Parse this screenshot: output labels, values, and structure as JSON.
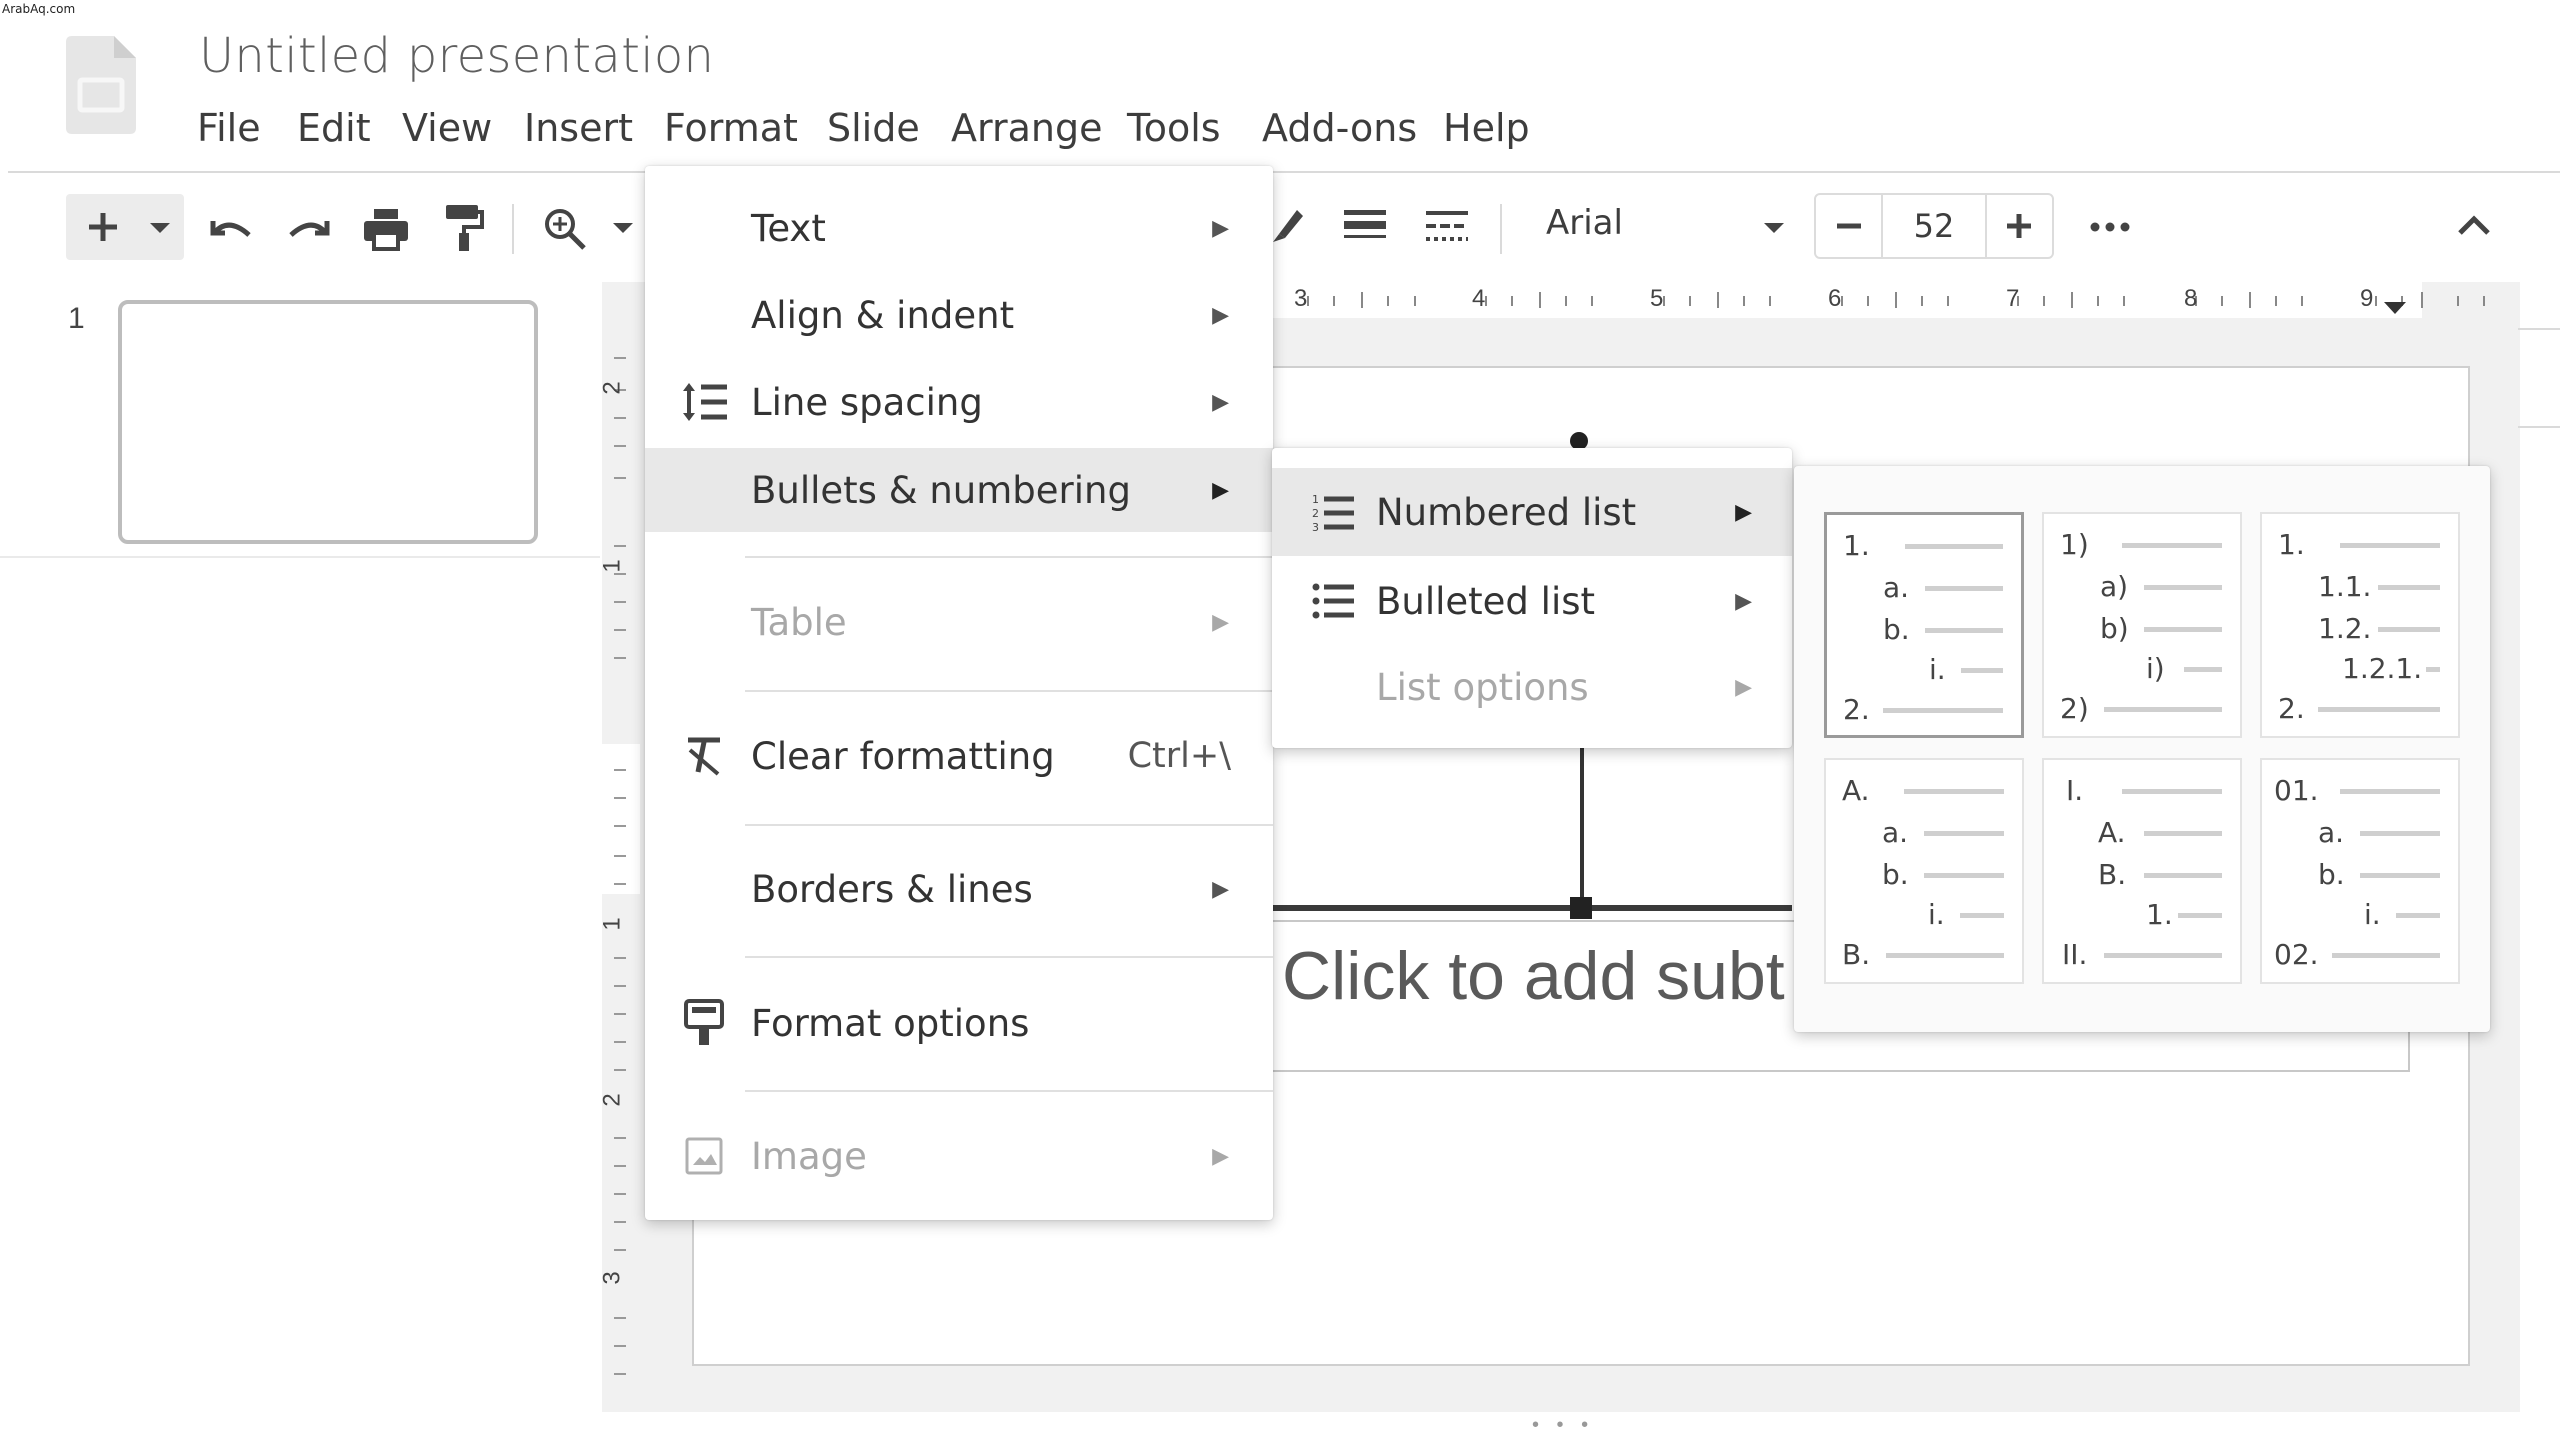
{
  "watermark": "ArabAq.com",
  "app": {
    "title": "Untitled presentation"
  },
  "menubar": [
    "File",
    "Edit",
    "View",
    "Insert",
    "Format",
    "Slide",
    "Arrange",
    "Tools",
    "Add-ons",
    "Help"
  ],
  "toolbar": {
    "font": "Arial",
    "font_size": "52",
    "icons": [
      "new-slide-icon",
      "undo-icon",
      "redo-icon",
      "print-icon",
      "paint-format-icon",
      "zoom-icon",
      "pen-icon",
      "line-weight-icon",
      "line-dash-icon",
      "minus-icon",
      "plus-icon",
      "more-icon",
      "collapse-icon"
    ]
  },
  "ruler": {
    "top_labels": [
      "3",
      "4",
      "5",
      "6",
      "7",
      "8",
      "9"
    ],
    "left_labels": [
      "2",
      "1",
      "1",
      "2",
      "3"
    ]
  },
  "filmstrip": {
    "slide_number": "1"
  },
  "slide": {
    "subtitle_placeholder": "Click to add subt"
  },
  "format_menu": {
    "items": {
      "text": "Text",
      "align": "Align & indent",
      "line_spacing": "Line spacing",
      "bullets": "Bullets & numbering",
      "table": "Table",
      "clear": "Clear formatting",
      "clear_shortcut": "Ctrl+\\",
      "borders": "Borders & lines",
      "format_options": "Format options",
      "image": "Image"
    }
  },
  "bullets_menu": {
    "numbered": "Numbered list",
    "bulleted": "Bulleted list",
    "options": "List options"
  },
  "numbered_presets": [
    [
      "1.",
      "a.",
      "b.",
      "i.",
      "2."
    ],
    [
      "1)",
      "a)",
      "b)",
      "i)",
      "2)"
    ],
    [
      "1.",
      "1.1.",
      "1.2.",
      "1.2.1.",
      "2."
    ],
    [
      "A.",
      "a.",
      "b.",
      "i.",
      "B."
    ],
    [
      "I.",
      "A.",
      "B.",
      "1.",
      "II."
    ],
    [
      "01.",
      "a.",
      "b.",
      "i.",
      "02."
    ]
  ]
}
